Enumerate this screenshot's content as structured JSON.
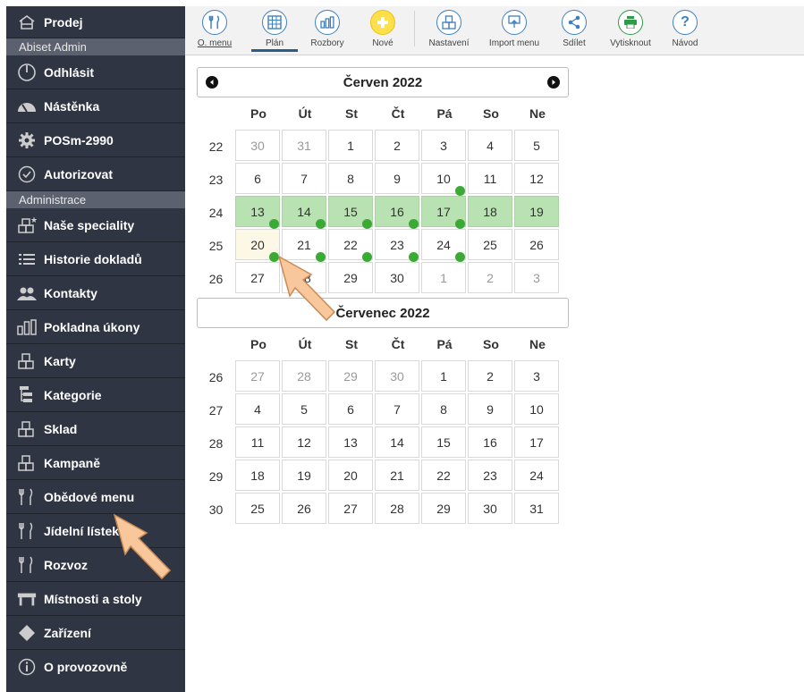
{
  "sidebar": {
    "items_top": [
      {
        "label": "Prodej",
        "icon": "home-icon"
      }
    ],
    "header1": "Abiset Admin",
    "items_mid": [
      {
        "label": "Odhlásit",
        "icon": "power-icon"
      },
      {
        "label": "Nástěnka",
        "icon": "gauge-icon"
      },
      {
        "label": "POSm-2990",
        "icon": "gear-icon"
      },
      {
        "label": "Autorizovat",
        "icon": "check-circle-icon"
      }
    ],
    "header2": "Administrace",
    "items_admin": [
      {
        "label": "Naše speciality",
        "icon": "star-boxes-icon"
      },
      {
        "label": "Historie dokladů",
        "icon": "list-icon"
      },
      {
        "label": "Kontakty",
        "icon": "people-icon"
      },
      {
        "label": "Pokladna úkony",
        "icon": "bars-icon"
      },
      {
        "label": "Karty",
        "icon": "boxes-icon"
      },
      {
        "label": "Kategorie",
        "icon": "tree-icon"
      },
      {
        "label": "Sklad",
        "icon": "boxes-icon"
      },
      {
        "label": "Kampaně",
        "icon": "boxes-icon"
      },
      {
        "label": "Obědové menu",
        "icon": "cutlery-icon"
      },
      {
        "label": "Jídelní lístek",
        "icon": "cutlery-icon"
      },
      {
        "label": "Rozvoz",
        "icon": "cutlery-icon"
      },
      {
        "label": "Místnosti a stoly",
        "icon": "table-icon"
      },
      {
        "label": "Zařízení",
        "icon": "diamond-icon"
      },
      {
        "label": "O provozovně",
        "icon": "info-icon"
      }
    ]
  },
  "toolbar": {
    "buttons": [
      {
        "label": "O. menu",
        "icon": "cutlery-icon"
      },
      {
        "label": "Plán",
        "icon": "calendar-grid-icon"
      },
      {
        "label": "Rozbory",
        "icon": "bar-chart-icon"
      },
      {
        "label": "Nové",
        "icon": "plus-icon"
      },
      {
        "label": "Nastavení",
        "icon": "boxes-icon"
      },
      {
        "label": "Import menu",
        "icon": "import-icon"
      },
      {
        "label": "Sdílet",
        "icon": "share-icon"
      },
      {
        "label": "Vytisknout",
        "icon": "print-icon"
      },
      {
        "label": "Návod",
        "icon": "help-icon"
      }
    ]
  },
  "calendar": {
    "weekday_headers": [
      "Po",
      "Út",
      "St",
      "Čt",
      "Pá",
      "So",
      "Ne"
    ],
    "june": {
      "title": "Červen 2022",
      "weeks": [
        {
          "num": "22",
          "days": [
            "30",
            "31",
            "1",
            "2",
            "3",
            "4",
            "5"
          ]
        },
        {
          "num": "23",
          "days": [
            "6",
            "7",
            "8",
            "9",
            "10",
            "11",
            "12"
          ]
        },
        {
          "num": "24",
          "days": [
            "13",
            "14",
            "15",
            "16",
            "17",
            "18",
            "19"
          ]
        },
        {
          "num": "25",
          "days": [
            "20",
            "21",
            "22",
            "23",
            "24",
            "25",
            "26"
          ]
        },
        {
          "num": "26",
          "days": [
            "27",
            "28",
            "29",
            "30",
            "1",
            "2",
            "3"
          ]
        }
      ]
    },
    "july": {
      "title": "Červenec 2022",
      "weeks": [
        {
          "num": "26",
          "days": [
            "27",
            "28",
            "29",
            "30",
            "1",
            "2",
            "3"
          ]
        },
        {
          "num": "27",
          "days": [
            "4",
            "5",
            "6",
            "7",
            "8",
            "9",
            "10"
          ]
        },
        {
          "num": "28",
          "days": [
            "11",
            "12",
            "13",
            "14",
            "15",
            "16",
            "17"
          ]
        },
        {
          "num": "29",
          "days": [
            "18",
            "19",
            "20",
            "21",
            "22",
            "23",
            "24"
          ]
        },
        {
          "num": "30",
          "days": [
            "25",
            "26",
            "27",
            "28",
            "29",
            "30",
            "31"
          ]
        }
      ]
    }
  },
  "colors": {
    "sidebar_bg": "#2f3542",
    "selected_week": "#b9e2b2",
    "today": "#fdf8e6",
    "menu_dot": "#3aaa35",
    "accent": "#3e7fc0"
  }
}
